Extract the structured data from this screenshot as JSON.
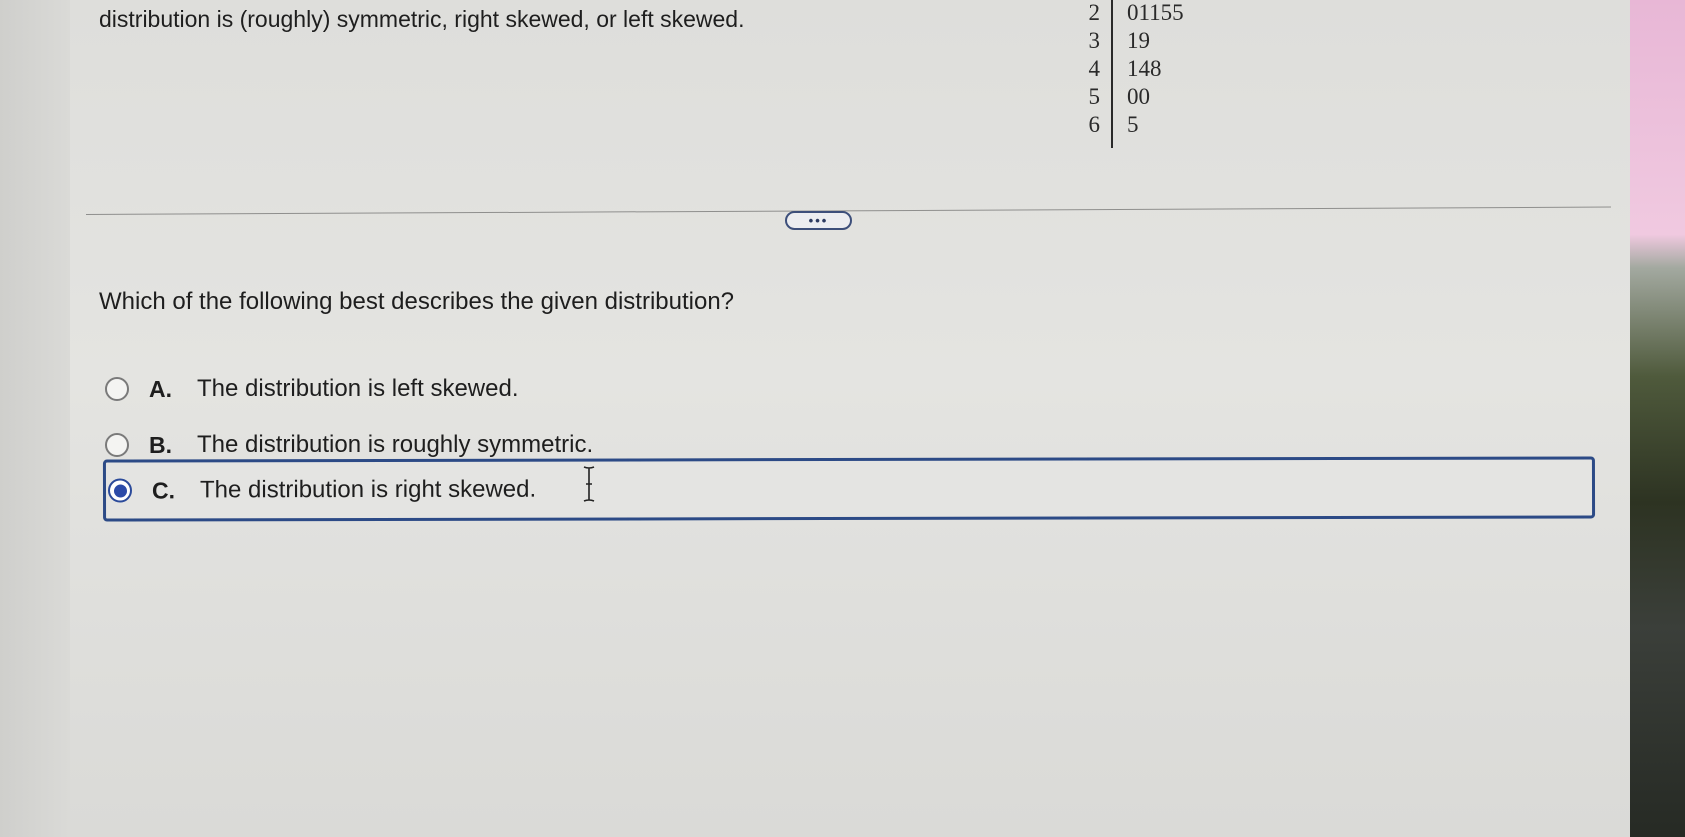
{
  "intro_text": "distribution is (roughly) symmetric, right skewed, or left skewed.",
  "stem_leaf": {
    "rows": [
      {
        "stem": "2",
        "leaves": "01155"
      },
      {
        "stem": "3",
        "leaves": "19"
      },
      {
        "stem": "4",
        "leaves": "148"
      },
      {
        "stem": "5",
        "leaves": "00"
      },
      {
        "stem": "6",
        "leaves": "5"
      }
    ]
  },
  "more_button": "•••",
  "question": "Which of the following best describes the given distribution?",
  "options": [
    {
      "letter": "A.",
      "text": "The distribution is left skewed.",
      "selected": false
    },
    {
      "letter": "B.",
      "text": "The distribution is roughly symmetric.",
      "selected": false
    },
    {
      "letter": "C.",
      "text": "The distribution is right skewed.",
      "selected": true
    }
  ],
  "colors": {
    "selection_border": "#2c4a86",
    "radio_selected": "#2b4aa8",
    "background": "#e2e2df"
  }
}
